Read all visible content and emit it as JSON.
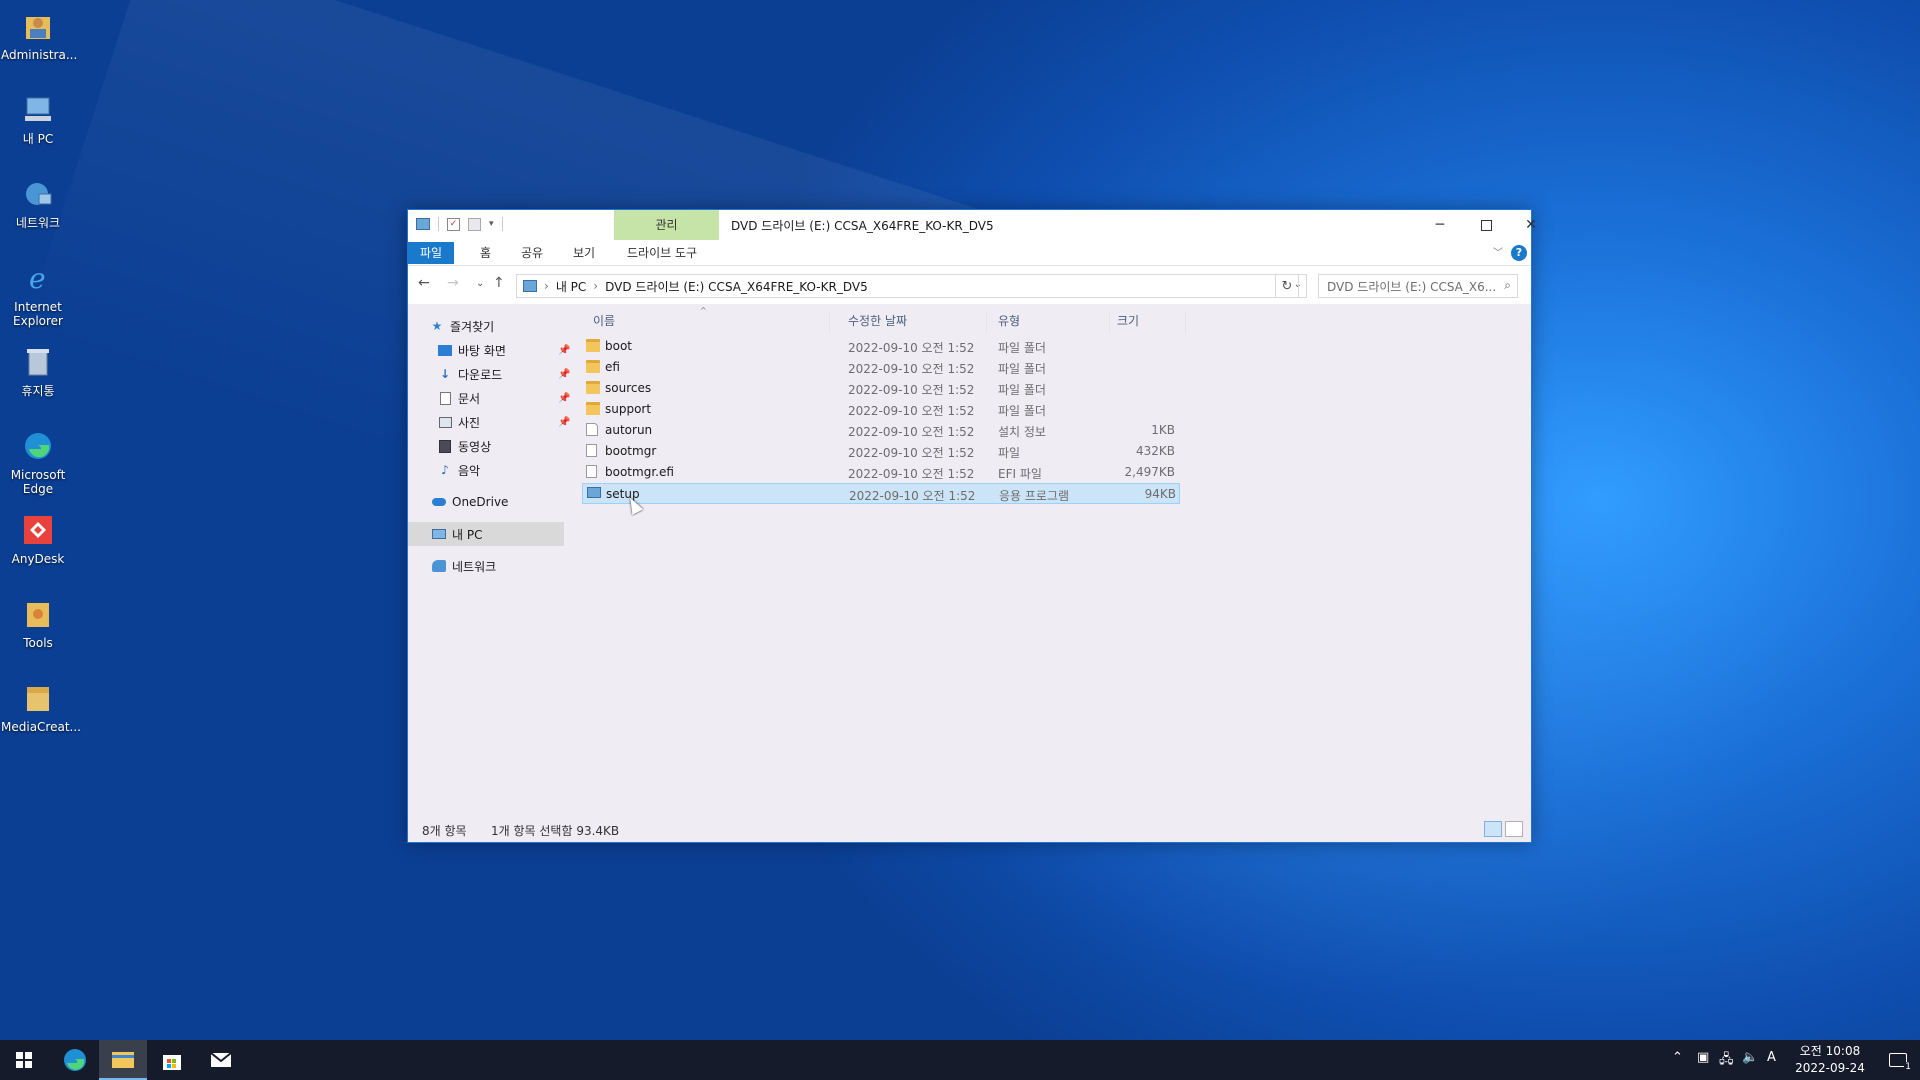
{
  "desktop": {
    "icons": [
      {
        "label": "Administra..."
      },
      {
        "label": "내 PC"
      },
      {
        "label": "네트워크"
      },
      {
        "label": "Internet Explorer"
      },
      {
        "label": "휴지통"
      },
      {
        "label": "Microsoft Edge"
      },
      {
        "label": "AnyDesk"
      },
      {
        "label": "Tools"
      },
      {
        "label": "MediaCreat..."
      }
    ]
  },
  "window": {
    "title": "DVD 드라이브 (E:) CCSA_X64FRE_KO-KR_DV5",
    "contextual_tab": "관리",
    "ribbon_tabs": [
      "파일",
      "홈",
      "공유",
      "보기",
      "드라이브 도구"
    ],
    "help": "?",
    "breadcrumb": [
      "내 PC",
      "DVD 드라이브 (E:) CCSA_X64FRE_KO-KR_DV5"
    ],
    "search_placeholder": "DVD 드라이브 (E:) CCSA_X6...",
    "navpane": {
      "quick_access": "즐겨찾기",
      "pinned": [
        "바탕 화면",
        "다운로드",
        "문서",
        "사진"
      ],
      "others": [
        "동영상",
        "음악"
      ],
      "onedrive": "OneDrive",
      "this_pc": "내 PC",
      "network": "네트워크"
    },
    "columns": {
      "name": "이름",
      "modified": "수정한 날짜",
      "type": "유형",
      "size": "크기"
    },
    "files": [
      {
        "name": "boot",
        "modified": "2022-09-10 오전 1:52",
        "type": "파일 폴더",
        "size": ""
      },
      {
        "name": "efi",
        "modified": "2022-09-10 오전 1:52",
        "type": "파일 폴더",
        "size": ""
      },
      {
        "name": "sources",
        "modified": "2022-09-10 오전 1:52",
        "type": "파일 폴더",
        "size": ""
      },
      {
        "name": "support",
        "modified": "2022-09-10 오전 1:52",
        "type": "파일 폴더",
        "size": ""
      },
      {
        "name": "autorun",
        "modified": "2022-09-10 오전 1:52",
        "type": "설치 정보",
        "size": "1KB"
      },
      {
        "name": "bootmgr",
        "modified": "2022-09-10 오전 1:52",
        "type": "파일",
        "size": "432KB"
      },
      {
        "name": "bootmgr.efi",
        "modified": "2022-09-10 오전 1:52",
        "type": "EFI 파일",
        "size": "2,497KB"
      },
      {
        "name": "setup",
        "modified": "2022-09-10 오전 1:52",
        "type": "응용 프로그램",
        "size": "94KB"
      }
    ],
    "status": {
      "count": "8개 항목",
      "selection": "1개 항목 선택함 93.4KB"
    }
  },
  "taskbar": {
    "time": "오전 10:08",
    "date": "2022-09-24",
    "ime": "A",
    "notifications": "1"
  }
}
